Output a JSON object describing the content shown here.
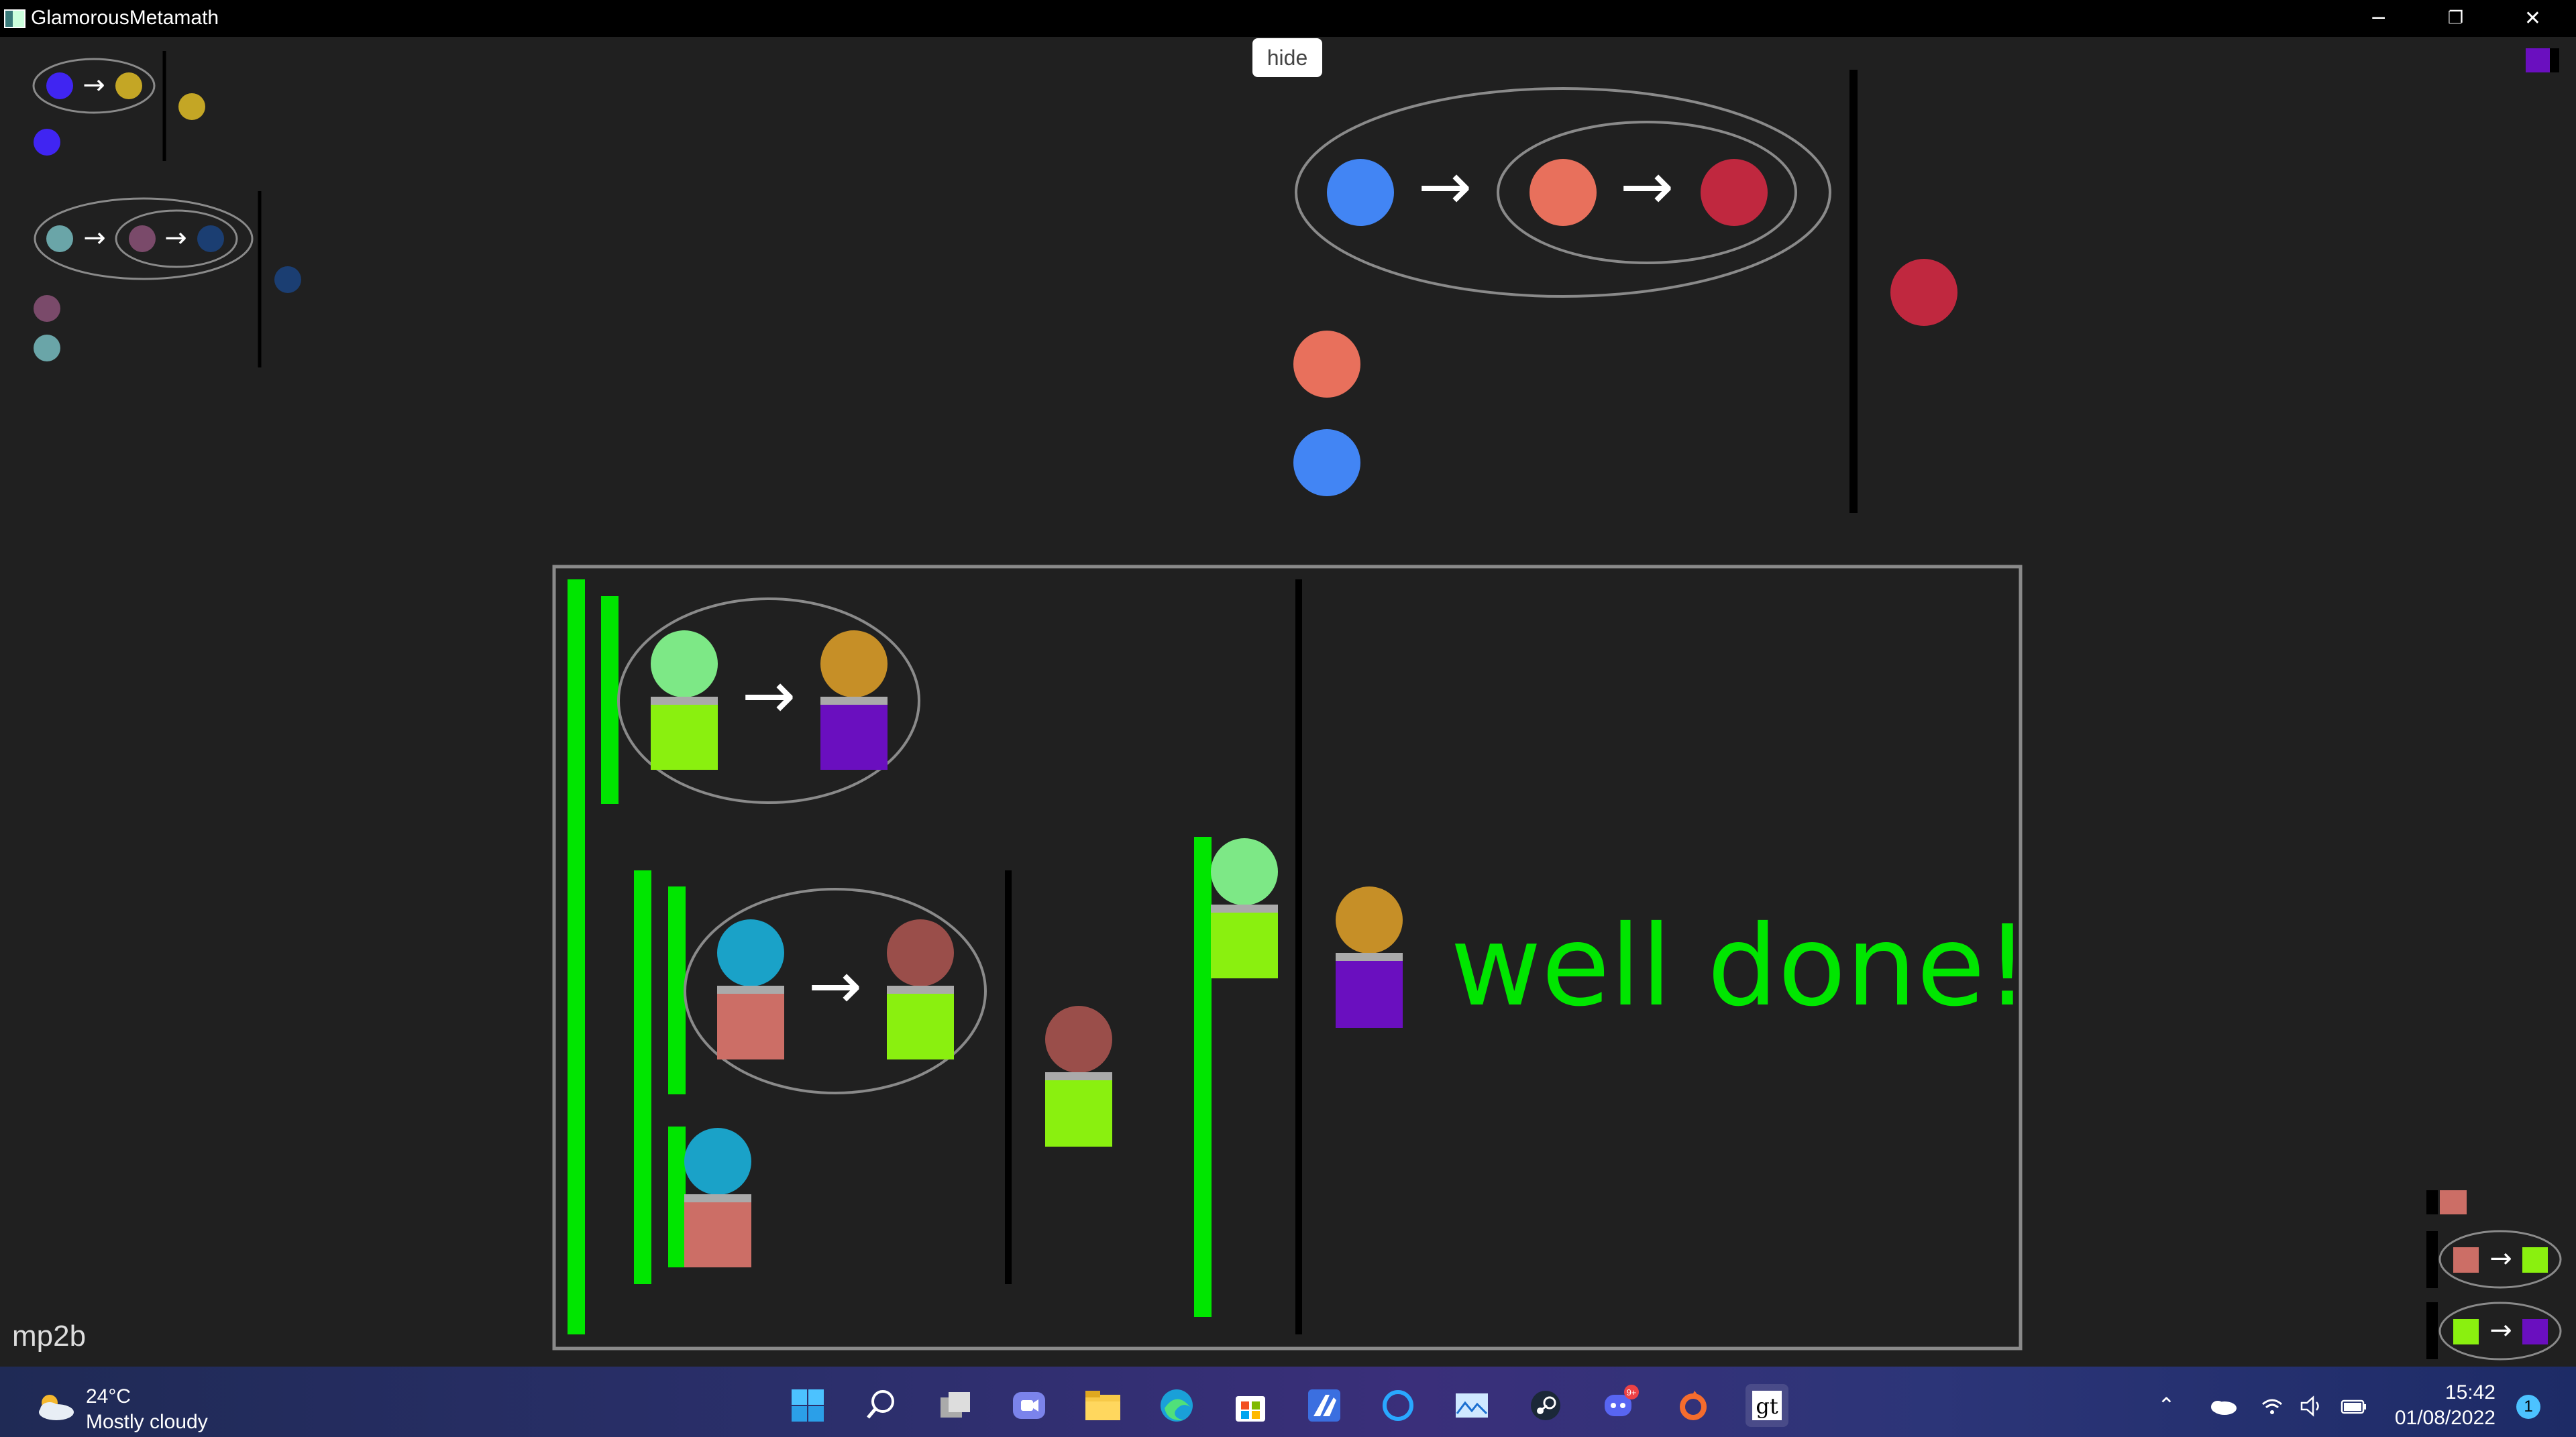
{
  "window": {
    "title": "GlamorousMetamath",
    "minimize_glyph": "─",
    "restore_glyph": "❐",
    "close_glyph": "✕"
  },
  "toolbar": {
    "hide_label": "hide"
  },
  "canvas": {
    "footer_label": "mp2b",
    "success_message": "well done!",
    "colors": {
      "background": "#202020",
      "proof_bar_green": "#00e600",
      "ellipse_outline": "#8a8a8a",
      "arrow": "#ffffff"
    },
    "arrow_glyph": "→"
  },
  "taskbar": {
    "weather": {
      "temperature": "24°C",
      "condition": "Mostly cloudy"
    },
    "apps": [
      "start-icon",
      "search-icon",
      "task-view-icon",
      "teams-chat-icon",
      "file-explorer-icon",
      "edge-icon",
      "store-icon",
      "app-icon",
      "cortana-icon",
      "photos-icon",
      "steam-icon",
      "discord-icon",
      "origin-icon",
      "glamoroustoolkit-icon"
    ],
    "discord_badge": "9+",
    "tray": {
      "time": "15:42",
      "date": "01/08/2022",
      "notifications": "1"
    }
  }
}
